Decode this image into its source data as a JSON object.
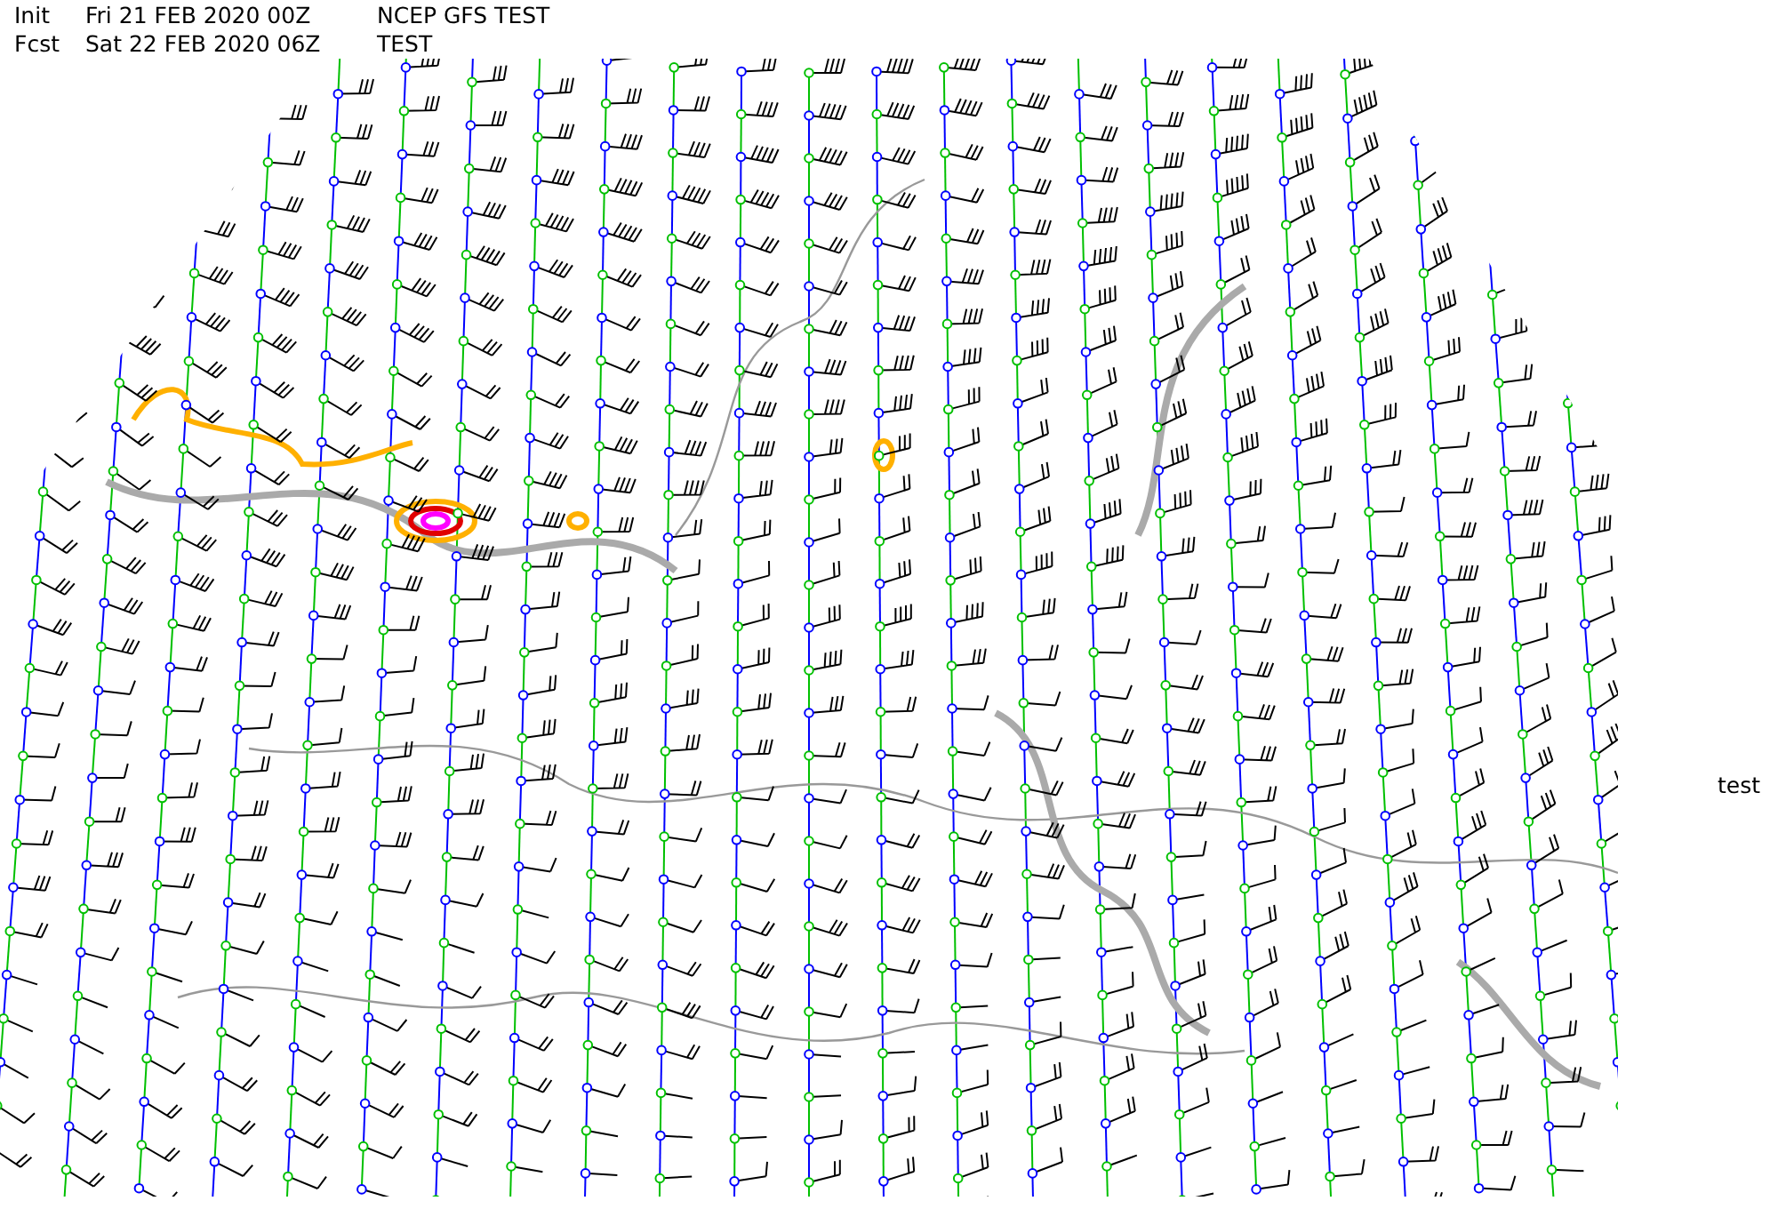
{
  "header": [
    {
      "label": "Init",
      "time": "Fri 21 FEB 2020 00Z",
      "model": "NCEP GFS TEST"
    },
    {
      "label": "Fcst",
      "time": "Sat 22 FEB 2020 06Z",
      "model": "TEST"
    }
  ],
  "side_label": "test"
}
